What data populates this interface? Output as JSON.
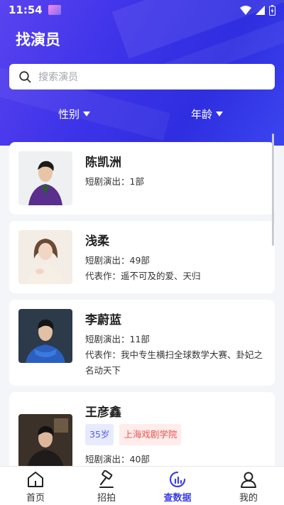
{
  "status": {
    "time": "11:54"
  },
  "header": {
    "title": "找演员",
    "search_placeholder": "搜索演员",
    "filters": [
      {
        "label": "性别"
      },
      {
        "label": "年龄"
      }
    ]
  },
  "actors": [
    {
      "name": "陈凯洲",
      "works": "短剧演出：1部"
    },
    {
      "name": "浅柔",
      "works": "短剧演出：49部",
      "rep": "代表作：遥不可及的爱、天归"
    },
    {
      "name": "李蔚蓝",
      "works": "短剧演出：11部",
      "rep": "代表作：我中专生横扫全球数学大赛、卦妃之名动天下"
    },
    {
      "name": "王彦鑫",
      "age": "35岁",
      "school": "上海戏剧学院",
      "works": "短剧演出：40部"
    }
  ],
  "tabbar": [
    {
      "label": "首页",
      "icon": "home-icon"
    },
    {
      "label": "招拍",
      "icon": "gavel-icon"
    },
    {
      "label": "查数据",
      "icon": "chart-icon",
      "active": true
    },
    {
      "label": "我的",
      "icon": "profile-icon"
    }
  ],
  "colors": {
    "accent": "#3d3fe3",
    "header": "#3d33e8"
  }
}
